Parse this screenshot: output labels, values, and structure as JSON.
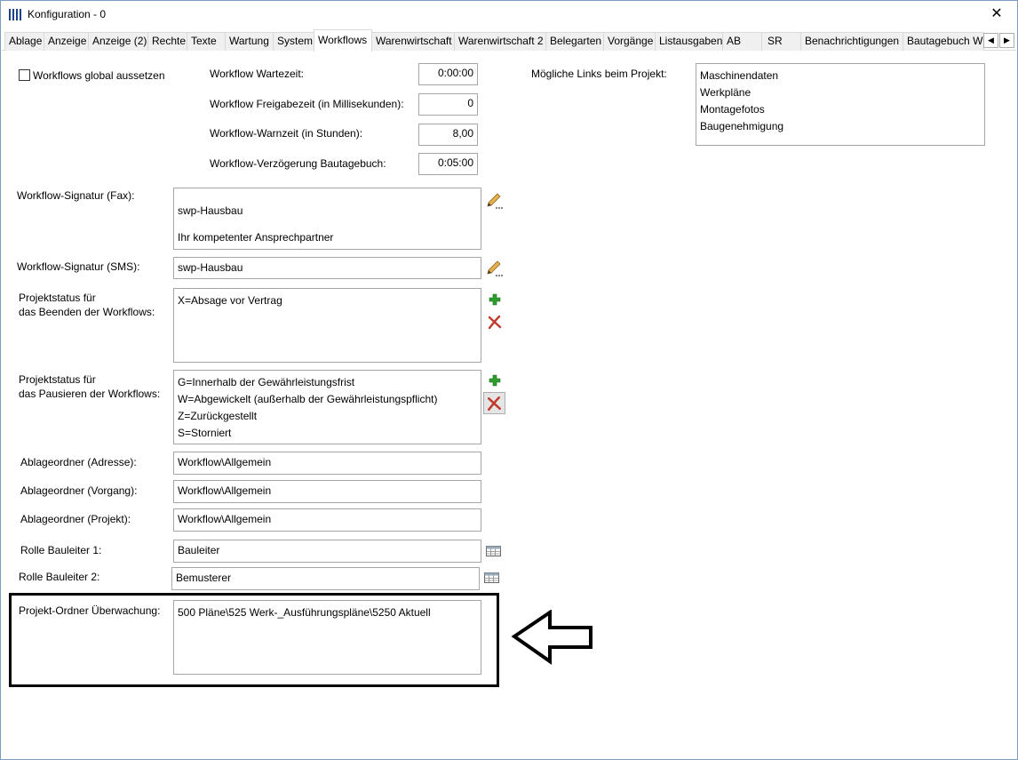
{
  "window": {
    "title": "Konfiguration - 0",
    "close_glyph": "✕"
  },
  "tabs": [
    {
      "label": "Ablage"
    },
    {
      "label": "Anzeige"
    },
    {
      "label": "Anzeige (2)"
    },
    {
      "label": "Rechte"
    },
    {
      "label": "Texte"
    },
    {
      "label": "Wartung"
    },
    {
      "label": "System"
    },
    {
      "label": "Workflows",
      "active": true
    },
    {
      "label": "Warenwirtschaft"
    },
    {
      "label": "Warenwirtschaft 2"
    },
    {
      "label": "Belegarten"
    },
    {
      "label": "Vorgänge"
    },
    {
      "label": "Listausgaben"
    },
    {
      "label": "AB"
    },
    {
      "label": "SR"
    },
    {
      "label": "Benachrichtigungen"
    },
    {
      "label": "Bautagebuch W"
    }
  ],
  "tab_scroll": {
    "left": "◀",
    "right": "▶"
  },
  "form": {
    "suspend_global": {
      "label": "Workflows global aussetzen",
      "checked": false
    },
    "wait_time": {
      "label": "Workflow Wartezeit:",
      "value": "0:00:00"
    },
    "release_time": {
      "label": "Workflow Freigabezeit (in Millisekunden):",
      "value": "0"
    },
    "warn_time": {
      "label": "Workflow-Warnzeit (in Stunden):",
      "value": "8,00"
    },
    "delay_diary": {
      "label": "Workflow-Verzögerung Bautagebuch:",
      "value": "0:05:00"
    },
    "links": {
      "label": "Mögliche Links beim Projekt:",
      "items": [
        "Maschinendaten",
        "Werkpläne",
        "Montagefotos",
        "Baugenehmigung"
      ]
    },
    "sig_fax": {
      "label": "Workflow-Signatur (Fax):",
      "lines": [
        "",
        "swp-Hausbau",
        "",
        "Ihr kompetenter Ansprechpartner"
      ]
    },
    "sig_sms": {
      "label": "Workflow-Signatur (SMS):",
      "value": "swp-Hausbau"
    },
    "status_end": {
      "label_line1": "Projektstatus für",
      "label_line2": "das Beenden der Workflows:",
      "items": [
        "X=Absage vor Vertrag"
      ]
    },
    "status_pause": {
      "label_line1": "Projektstatus für",
      "label_line2": "das Pausieren der Workflows:",
      "items": [
        "G=Innerhalb der Gewährleistungsfrist",
        "W=Abgewickelt (außerhalb der Gewährleistungspflicht)",
        "Z=Zurückgestellt",
        "S=Storniert"
      ]
    },
    "folder_address": {
      "label": "Ablageordner (Adresse):",
      "value": "Workflow\\Allgemein"
    },
    "folder_process": {
      "label": "Ablageordner (Vorgang):",
      "value": "Workflow\\Allgemein"
    },
    "folder_project": {
      "label": "Ablageordner (Projekt):",
      "value": "Workflow\\Allgemein"
    },
    "role1": {
      "label": "Rolle Bauleiter 1:",
      "value": "Bauleiter"
    },
    "role2": {
      "label": "Rolle Bauleiter 2:",
      "value": "Bemusterer"
    },
    "monitor_folder": {
      "label": "Projekt-Ordner Überwachung:",
      "value": "500 Pläne\\525 Werk-_Ausführungspläne\\5250 Aktuell"
    }
  },
  "colors": {
    "add": "#2e9e2e",
    "delete": "#c0392b",
    "tab_bg": "#f0f0f0",
    "border": "#a6a6a6"
  }
}
